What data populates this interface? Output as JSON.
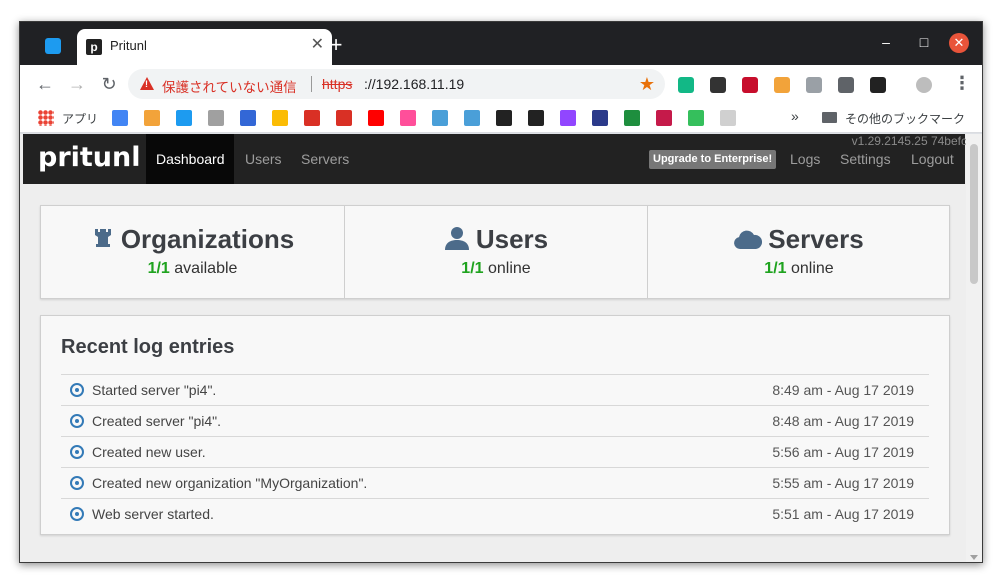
{
  "browser": {
    "tab_title": "Pritunl",
    "new_tab": "+",
    "window_minimize": "–",
    "window_maximize": "□",
    "window_close": "✕",
    "tab_close": "✕",
    "nav_back": "←",
    "nav_forward": "→",
    "nav_reload": "↻",
    "security_warning": "保護されていない通信",
    "url_scheme": "https",
    "url_rest": "://192.168.11.19",
    "menu": "⋮",
    "extensions": [
      {
        "name": "rewind-ext-icon",
        "color": "#12b886"
      },
      {
        "name": "buffer-ext-icon",
        "color": "#333333"
      },
      {
        "name": "adblock-plus-icon",
        "color": "#c70d2c"
      },
      {
        "name": "rss-ext-icon",
        "color": "#f2a33a"
      },
      {
        "name": "block-ext-icon",
        "color": "#9aa0a6"
      },
      {
        "name": "gesture-ext-icon",
        "color": "#5f6368"
      },
      {
        "name": "pocket-ext-icon",
        "color": "#222222"
      },
      {
        "name": "profile-avatar-icon",
        "color": "#bdbdbd"
      }
    ],
    "bookmarks": {
      "apps_label": "アプリ",
      "other_label": "その他のブックマーク",
      "overflow": "»",
      "items": [
        {
          "name": "google-translate-bookmark",
          "color": "#4285f4"
        },
        {
          "name": "rss-bookmark",
          "color": "#f2a33a"
        },
        {
          "name": "twitter-bookmark",
          "color": "#1d9bf0"
        },
        {
          "name": "saturn-bookmark",
          "color": "#a0a0a0"
        },
        {
          "name": "calendar-bookmark",
          "color": "#3367d6"
        },
        {
          "name": "keep-bookmark",
          "color": "#fbbc04"
        },
        {
          "name": "gmail-bookmark",
          "color": "#d93025"
        },
        {
          "name": "gmail-2-bookmark",
          "color": "#d93025"
        },
        {
          "name": "youtube-bookmark",
          "color": "#ff0000"
        },
        {
          "name": "pink-app-bookmark",
          "color": "#ff4f9a"
        },
        {
          "name": "flight-bookmark",
          "color": "#4a9fd8"
        },
        {
          "name": "flight-2-bookmark",
          "color": "#4a9fd8"
        },
        {
          "name": "github-bookmark",
          "color": "#222222"
        },
        {
          "name": "github-2-bookmark",
          "color": "#222222"
        },
        {
          "name": "twitch-bookmark",
          "color": "#9146ff"
        },
        {
          "name": "news-bookmark",
          "color": "#2b3a8a"
        },
        {
          "name": "green-search-bookmark",
          "color": "#1e8e3e"
        },
        {
          "name": "raspberry-pi-bookmark",
          "color": "#c51a4a"
        },
        {
          "name": "manjaro-bookmark",
          "color": "#35bf5c"
        },
        {
          "name": "faded-bookmark",
          "color": "#d0d0d0"
        }
      ]
    }
  },
  "pritunl": {
    "version": "v1.29.2145.25 74befc",
    "brand": "pritunl",
    "nav": [
      "Dashboard",
      "Users",
      "Servers"
    ],
    "upgrade": "Upgrade to Enterprise!",
    "nav_right": [
      "Logs",
      "Settings",
      "Logout"
    ],
    "stats": [
      {
        "icon": "rook-icon",
        "title": "Organizations",
        "count": "1/1",
        "label": "available"
      },
      {
        "icon": "user-icon",
        "title": "Users",
        "count": "1/1",
        "label": "online"
      },
      {
        "icon": "cloud-icon",
        "title": "Servers",
        "count": "1/1",
        "label": "online"
      }
    ],
    "log_title": "Recent log entries",
    "logs": [
      {
        "message": "Started server \"pi4\".",
        "time": "8:49 am - Aug 17 2019"
      },
      {
        "message": "Created server \"pi4\".",
        "time": "8:48 am - Aug 17 2019"
      },
      {
        "message": "Created new user.",
        "time": "5:56 am - Aug 17 2019"
      },
      {
        "message": "Created new organization \"MyOrganization\".",
        "time": "5:55 am - Aug 17 2019"
      },
      {
        "message": "Web server started.",
        "time": "5:51 am - Aug 17 2019"
      }
    ],
    "accent_green": "#1fa31f",
    "accent_blue": "#337ab7"
  }
}
